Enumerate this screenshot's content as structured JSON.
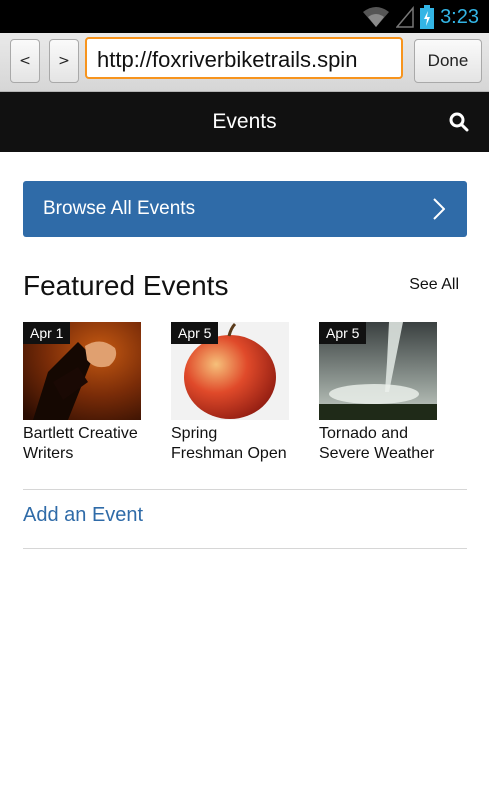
{
  "statusbar": {
    "time": "3:23",
    "icons": [
      "wifi-icon",
      "signal-icon",
      "battery-charging-icon"
    ]
  },
  "browser": {
    "back_label": "<",
    "forward_label": ">",
    "url": "http://foxriverbiketrails.spin",
    "done_label": "Done"
  },
  "header": {
    "title": "Events",
    "search_icon": "search-icon"
  },
  "browse": {
    "label": "Browse All Events",
    "icon": "chevron-right-icon"
  },
  "featured": {
    "title": "Featured Events",
    "see_all": "See All",
    "events": [
      {
        "date": "Apr 1",
        "name": "Bartlett Creative Writers"
      },
      {
        "date": "Apr 5",
        "name": "Spring Freshman Open"
      },
      {
        "date": "Apr 5",
        "name": "Tornado and Severe Weather"
      }
    ]
  },
  "add_event": {
    "label": "Add an Event"
  },
  "colors": {
    "accent": "#2f6ba8",
    "header_bg": "#111111",
    "url_border": "#f7941d"
  }
}
